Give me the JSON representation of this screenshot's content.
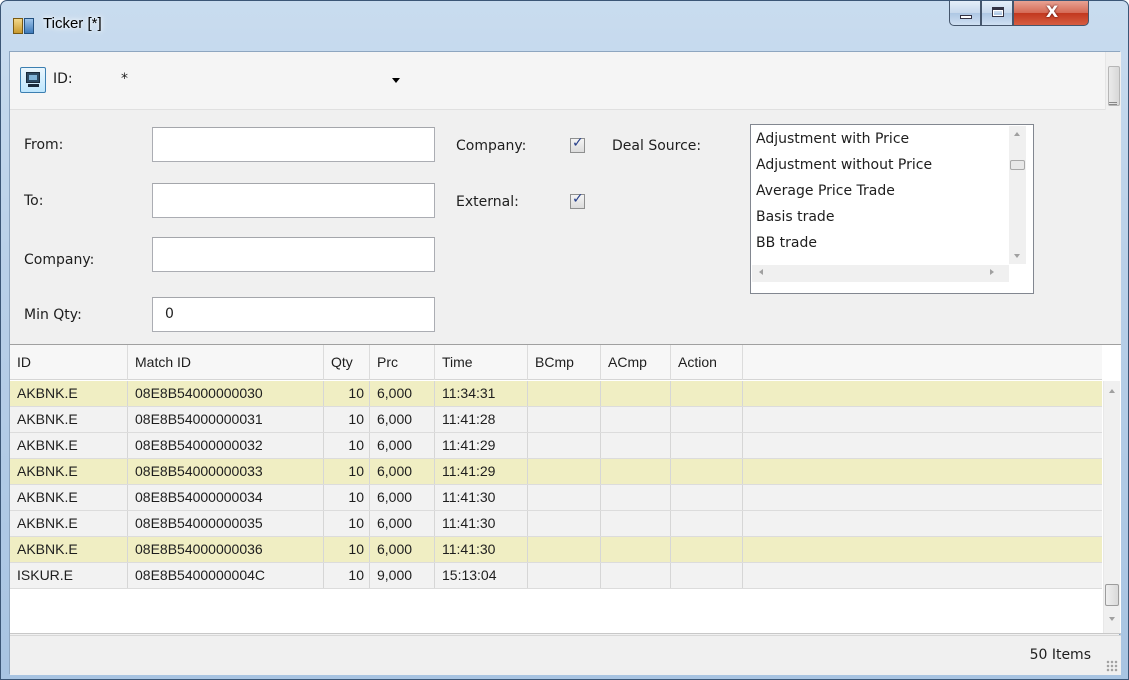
{
  "window": {
    "title": "Ticker [*]",
    "close_glyph": "X"
  },
  "toolbar": {
    "icon": "monitor-icon",
    "id_label": "ID:",
    "id_value": "*"
  },
  "filter": {
    "from_label": "From:",
    "from_value": "",
    "to_label": "To:",
    "to_value": "",
    "company_label": "Company:",
    "company_value": "",
    "min_qty_label": "Min Qty:",
    "min_qty_value": "0",
    "company_check_label": "Company:",
    "company_checked": true,
    "external_label": "External:",
    "external_checked": true,
    "deal_source_label": "Deal Source:",
    "deal_sources": [
      "Adjustment with Price",
      "Adjustment without Price",
      "Average Price Trade",
      "Basis trade",
      "BB trade"
    ]
  },
  "grid": {
    "columns": [
      "ID",
      "Match ID",
      "Qty",
      "Prc",
      "Time",
      "BCmp",
      "ACmp",
      "Action"
    ],
    "rows": [
      {
        "id": "AKBNK.E",
        "match_id": "08E8B54000000030",
        "qty": "10",
        "prc": "6,000",
        "time": "11:34:31",
        "highlight": true
      },
      {
        "id": "AKBNK.E",
        "match_id": "08E8B54000000031",
        "qty": "10",
        "prc": "6,000",
        "time": "11:41:28",
        "highlight": false
      },
      {
        "id": "AKBNK.E",
        "match_id": "08E8B54000000032",
        "qty": "10",
        "prc": "6,000",
        "time": "11:41:29",
        "highlight": false
      },
      {
        "id": "AKBNK.E",
        "match_id": "08E8B54000000033",
        "qty": "10",
        "prc": "6,000",
        "time": "11:41:29",
        "highlight": true
      },
      {
        "id": "AKBNK.E",
        "match_id": "08E8B54000000034",
        "qty": "10",
        "prc": "6,000",
        "time": "11:41:30",
        "highlight": false
      },
      {
        "id": "AKBNK.E",
        "match_id": "08E8B54000000035",
        "qty": "10",
        "prc": "6,000",
        "time": "11:41:30",
        "highlight": false
      },
      {
        "id": "AKBNK.E",
        "match_id": "08E8B54000000036",
        "qty": "10",
        "prc": "6,000",
        "time": "11:41:30",
        "highlight": true
      },
      {
        "id": "ISKUR.E",
        "match_id": "08E8B5400000004C",
        "qty": "10",
        "prc": "9,000",
        "time": "15:13:04",
        "highlight": false
      }
    ]
  },
  "status": {
    "items_text": "50 Items"
  },
  "colors": {
    "highlight_row": "#f0eec3",
    "normal_row": "#f2f2f2",
    "title_bar": "#b9d0e8",
    "close_button": "#c2381f"
  }
}
